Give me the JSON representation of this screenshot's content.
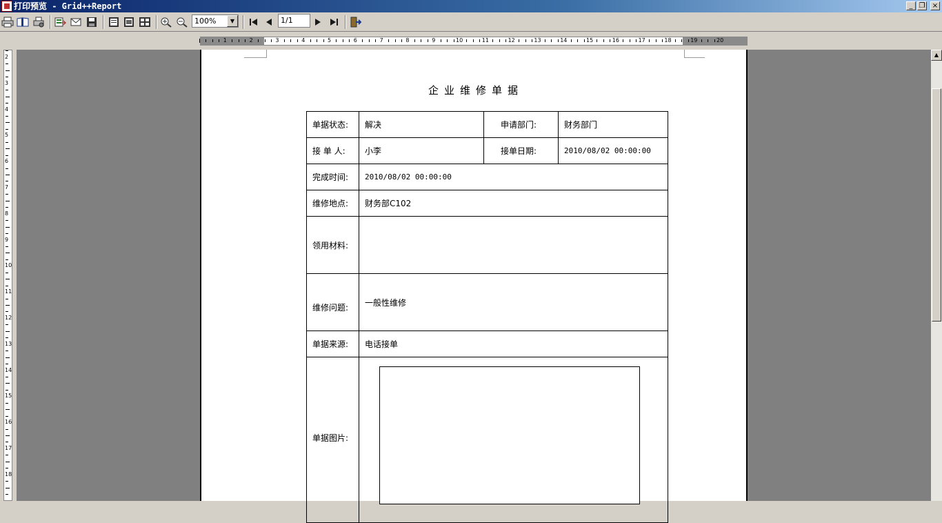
{
  "window": {
    "title": "打印预览 - Grid++Report",
    "controls": [
      "_",
      "❐",
      "×"
    ]
  },
  "toolbar": {
    "zoom_value": "100%",
    "page_value": "1/1",
    "buttons": [
      "print-icon",
      "print-setup-icon",
      "printer-properties-icon",
      "export-icon",
      "email-icon",
      "save-icon",
      "single-page-icon",
      "page-width-icon",
      "multi-page-icon",
      "zoom-in-icon",
      "zoom-out-icon",
      "first-page-icon",
      "previous-page-icon",
      "next-page-icon",
      "last-page-icon",
      "close-preview-icon"
    ]
  },
  "ruler": {
    "horizontal": [
      "1",
      "2",
      "3",
      "4",
      "5",
      "6",
      "7",
      "8",
      "9",
      "10",
      "11",
      "12",
      "13",
      "14",
      "15",
      "16",
      "17",
      "18",
      "19",
      "20"
    ],
    "vertical": [
      "2",
      "3",
      "4",
      "5",
      "6",
      "7",
      "8",
      "9",
      "10",
      "11",
      "12",
      "13",
      "14",
      "15",
      "16",
      "17",
      "18"
    ]
  },
  "report": {
    "title": "企业维修单据",
    "status_label": "单据状态:",
    "status_value": "解决",
    "dept_label": "申请部门:",
    "dept_value": "财务部门",
    "receiver_label": "接 单 人:",
    "receiver_value": "小李",
    "order_date_label": "接单日期:",
    "order_date_value": "2010/08/02 00:00:00",
    "finish_time_label": "完成时间:",
    "finish_time_value": "2010/08/02 00:00:00",
    "location_label": "维修地点:",
    "location_value": "财务部C102",
    "materials_label": "领用材料:",
    "materials_value": "",
    "issue_label": "维修问题:",
    "issue_value": "一般性维修",
    "source_label": "单据来源:",
    "source_value": "电话接单",
    "picture_label": "单据图片:"
  }
}
